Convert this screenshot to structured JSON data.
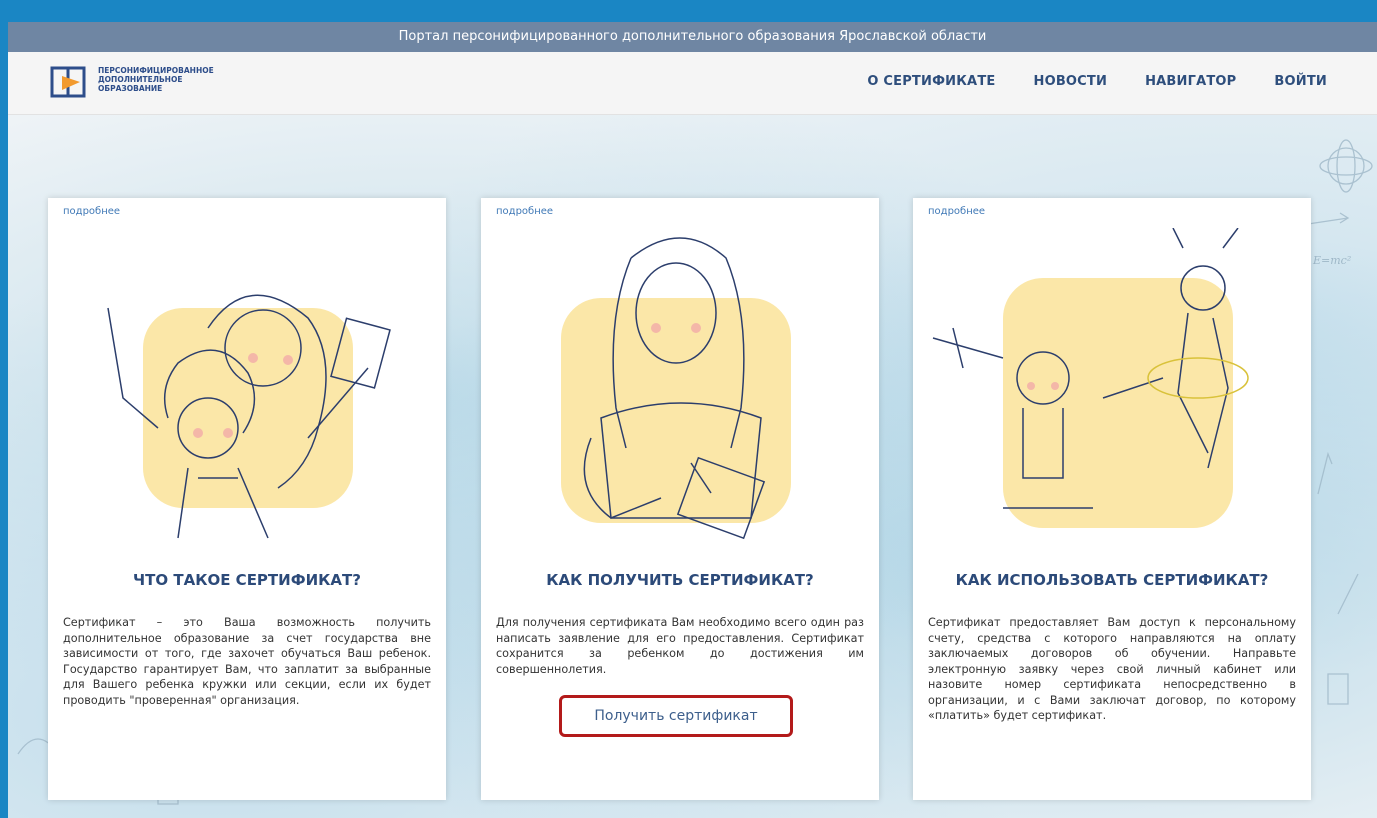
{
  "topbar": {
    "title": "Портал персонифицированного дополнительного образования Ярославской области"
  },
  "logo": {
    "line1": "ПЕРСОНИФИЦИРОВАННОЕ",
    "line2": "ДОПОЛНИТЕЛЬНОЕ",
    "line3": "ОБРАЗОВАНИЕ"
  },
  "nav": {
    "items": [
      {
        "label": "О СЕРТИФИКАТЕ"
      },
      {
        "label": "НОВОСТИ"
      },
      {
        "label": "НАВИГАТОР"
      },
      {
        "label": "ВОЙТИ"
      }
    ]
  },
  "cards": [
    {
      "more": "подробнее",
      "title": "ЧТО ТАКОЕ СЕРТИФИКАТ?",
      "text": "Сертификат – это Ваша возможность получить дополнительное образование за счет государства вне зависимости от того, где захочет обучаться Ваш ребенок. Государство гарантирует Вам, что заплатит за выбранные для Вашего ребенка кружки или секции, если их будет проводить \"проверенная\" организация."
    },
    {
      "more": "подробнее",
      "title": "КАК ПОЛУЧИТЬ СЕРТИФИКАТ?",
      "text": "Для получения сертификата Вам необходимо всего один раз написать заявление для его предоставления. Сертификат сохранится за ребенком до достижения им совершеннолетия.",
      "button": "Получить сертификат"
    },
    {
      "more": "подробнее",
      "title": "КАК ИСПОЛЬЗОВАТЬ СЕРТИФИКАТ?",
      "text": "Сертификат предоставляет Вам доступ к персональному счету, средства с которого направляются на оплату заключаемых договоров об обучении. Направьте электронную заявку через свой личный кабинет или назовите номер сертификата непосредственно в организации, и с Вами заключат договор, по которому «платить» будет сертификат."
    }
  ],
  "colors": {
    "frame": "#1a86c4",
    "topbar": "#6f86a3",
    "title": "#2c4a79",
    "highlight": "#b31a1a",
    "yellow": "#fbe7a8"
  }
}
